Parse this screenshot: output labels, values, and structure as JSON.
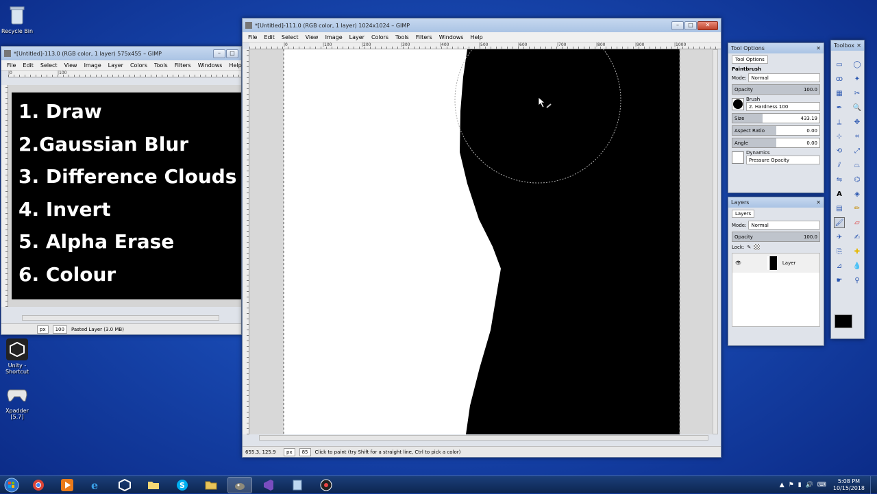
{
  "desktop": {
    "icons": [
      {
        "label": "Recycle Bin"
      },
      {
        "label": "Unity - Shortcut"
      },
      {
        "label": "Xpadder [5.7]"
      }
    ]
  },
  "small_window": {
    "title": "*[Untitled]-113.0 (RGB color, 1 layer) 575x455 – GIMP",
    "menu": [
      "File",
      "Edit",
      "Select",
      "View",
      "Image",
      "Layer",
      "Colors",
      "Tools",
      "Filters",
      "Windows",
      "Help"
    ],
    "ruler_marks": [
      "|0",
      "|100"
    ],
    "lines": [
      "1. Draw",
      "2.Gaussian Blur",
      "3. Difference Clouds",
      "4. Invert",
      "5. Alpha Erase",
      "6. Colour"
    ],
    "status": {
      "unit": "px",
      "zoom": "100",
      "message": "Pasted Layer (3.0 MB)"
    }
  },
  "main_window": {
    "title": "*[Untitled]-111.0 (RGB color, 1 layer) 1024x1024 – GIMP",
    "menu": [
      "File",
      "Edit",
      "Select",
      "View",
      "Image",
      "Layer",
      "Colors",
      "Tools",
      "Filters",
      "Windows",
      "Help"
    ],
    "ruler_marks": [
      "|0",
      "|100",
      "|200",
      "|300",
      "|400",
      "|500",
      "|600",
      "|700",
      "|800",
      "|900",
      "|1000"
    ],
    "status": {
      "coords": "655.3, 125.9",
      "unit": "px",
      "zoom": "85",
      "message": "Click to paint (try Shift for a straight line, Ctrl to pick a color)"
    }
  },
  "tool_options": {
    "title": "Tool Options",
    "tab": "Tool Options",
    "tool_name": "Paintbrush",
    "mode_label": "Mode:",
    "mode_value": "Normal",
    "opacity_label": "Opacity",
    "opacity_value": "100.0",
    "brush_label": "Brush",
    "brush_value": "2. Hardness 100",
    "size_label": "Size",
    "size_value": "433.19",
    "aspect_label": "Aspect Ratio",
    "aspect_value": "0.00",
    "angle_label": "Angle",
    "angle_value": "0.00",
    "dynamics_label": "Dynamics",
    "dynamics_value": "Pressure Opacity"
  },
  "layers": {
    "title": "Layers",
    "tab": "Layers",
    "mode_label": "Mode:",
    "mode_value": "Normal",
    "opacity_label": "Opacity",
    "opacity_value": "100.0",
    "lock_label": "Lock:",
    "layer_name": "Layer"
  },
  "toolbox": {
    "title": "Toolbox"
  },
  "taskbar": {
    "time": "5:08 PM",
    "date": "10/15/2018"
  }
}
